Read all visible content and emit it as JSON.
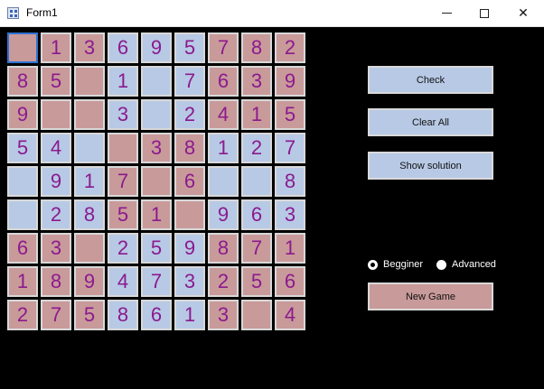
{
  "window": {
    "title": "Form1",
    "controls": {
      "minimize": "—",
      "maximize": "□",
      "close": "✕"
    }
  },
  "colors": {
    "pink": "#c99a9a",
    "blue": "#b7c9e5",
    "digit": "#8b1a8f",
    "background": "#000000"
  },
  "board": {
    "rows": [
      [
        null,
        1,
        3,
        6,
        9,
        5,
        7,
        8,
        2
      ],
      [
        8,
        5,
        null,
        1,
        null,
        7,
        6,
        3,
        9
      ],
      [
        9,
        null,
        null,
        3,
        null,
        2,
        4,
        1,
        5
      ],
      [
        5,
        4,
        null,
        null,
        3,
        8,
        1,
        2,
        7
      ],
      [
        null,
        9,
        1,
        7,
        null,
        6,
        null,
        null,
        8
      ],
      [
        null,
        2,
        8,
        5,
        1,
        null,
        9,
        6,
        3
      ],
      [
        6,
        3,
        null,
        2,
        5,
        9,
        8,
        7,
        1
      ],
      [
        1,
        8,
        9,
        4,
        7,
        3,
        2,
        5,
        6
      ],
      [
        2,
        7,
        5,
        8,
        6,
        1,
        3,
        null,
        4
      ]
    ],
    "colors": [
      [
        "pink",
        "pink",
        "pink",
        "blue",
        "blue",
        "blue",
        "pink",
        "pink",
        "pink"
      ],
      [
        "pink",
        "pink",
        "pink",
        "blue",
        "blue",
        "blue",
        "pink",
        "pink",
        "pink"
      ],
      [
        "pink",
        "pink",
        "pink",
        "blue",
        "blue",
        "blue",
        "pink",
        "pink",
        "pink"
      ],
      [
        "blue",
        "blue",
        "blue",
        "pink",
        "pink",
        "pink",
        "blue",
        "blue",
        "blue"
      ],
      [
        "blue",
        "blue",
        "blue",
        "pink",
        "pink",
        "pink",
        "blue",
        "blue",
        "blue"
      ],
      [
        "blue",
        "blue",
        "blue",
        "pink",
        "pink",
        "pink",
        "blue",
        "blue",
        "blue"
      ],
      [
        "pink",
        "pink",
        "pink",
        "blue",
        "blue",
        "blue",
        "pink",
        "pink",
        "pink"
      ],
      [
        "pink",
        "pink",
        "pink",
        "blue",
        "blue",
        "blue",
        "pink",
        "pink",
        "pink"
      ],
      [
        "pink",
        "pink",
        "pink",
        "blue",
        "blue",
        "blue",
        "pink",
        "pink",
        "pink"
      ]
    ],
    "selected": [
      0,
      0
    ]
  },
  "buttons": {
    "check": "Check",
    "clear_all": "Clear All",
    "show_solution": "Show solution",
    "new_game": "New Game"
  },
  "difficulty": {
    "options": [
      {
        "label": "Begginer",
        "checked": true
      },
      {
        "label": "Advanced",
        "checked": false
      }
    ]
  }
}
